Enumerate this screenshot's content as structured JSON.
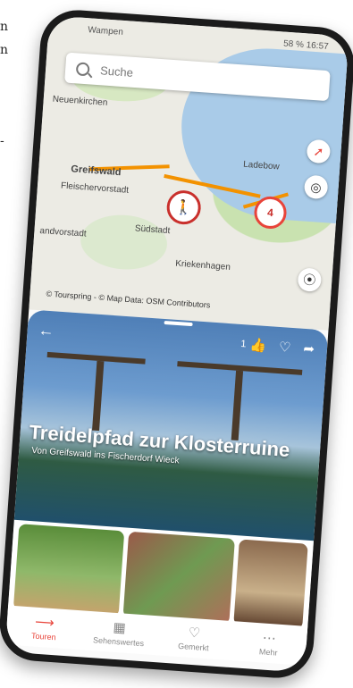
{
  "side_text": [
    "n",
    "n",
    "-"
  ],
  "status": {
    "location": "Wampen",
    "right": "58 % 16:57"
  },
  "search": {
    "placeholder": "Suche"
  },
  "map": {
    "labels": [
      "Neuenkirchen",
      "Greifswald",
      "Fleischervorstadt",
      "Südstadt",
      "Ladebow",
      "Kriekenhagen",
      "andvorstadt"
    ],
    "cluster_count": "4",
    "attribution": "© Tourspring - © Map Data: OSM Contributors",
    "route_color": "#f39200",
    "marker_color": "#c9302c",
    "icons": [
      "compass-icon",
      "locate-icon",
      "layers-icon",
      "hiker-icon"
    ]
  },
  "tour": {
    "likes": "1",
    "title": "Treidelpfad zur Klosterruine",
    "subtitle": "Von Greifswald ins Fischerdorf Wieck"
  },
  "tabs": [
    {
      "label": "Touren",
      "icon": "route-icon",
      "active": true
    },
    {
      "label": "Sehenswertes",
      "icon": "picture-icon",
      "active": false
    },
    {
      "label": "Gemerkt",
      "icon": "heart-icon",
      "active": false
    },
    {
      "label": "Mehr",
      "icon": "more-icon",
      "active": false
    }
  ],
  "nav": [
    "◁",
    "○",
    "□"
  ],
  "accent_color": "#e8443a"
}
